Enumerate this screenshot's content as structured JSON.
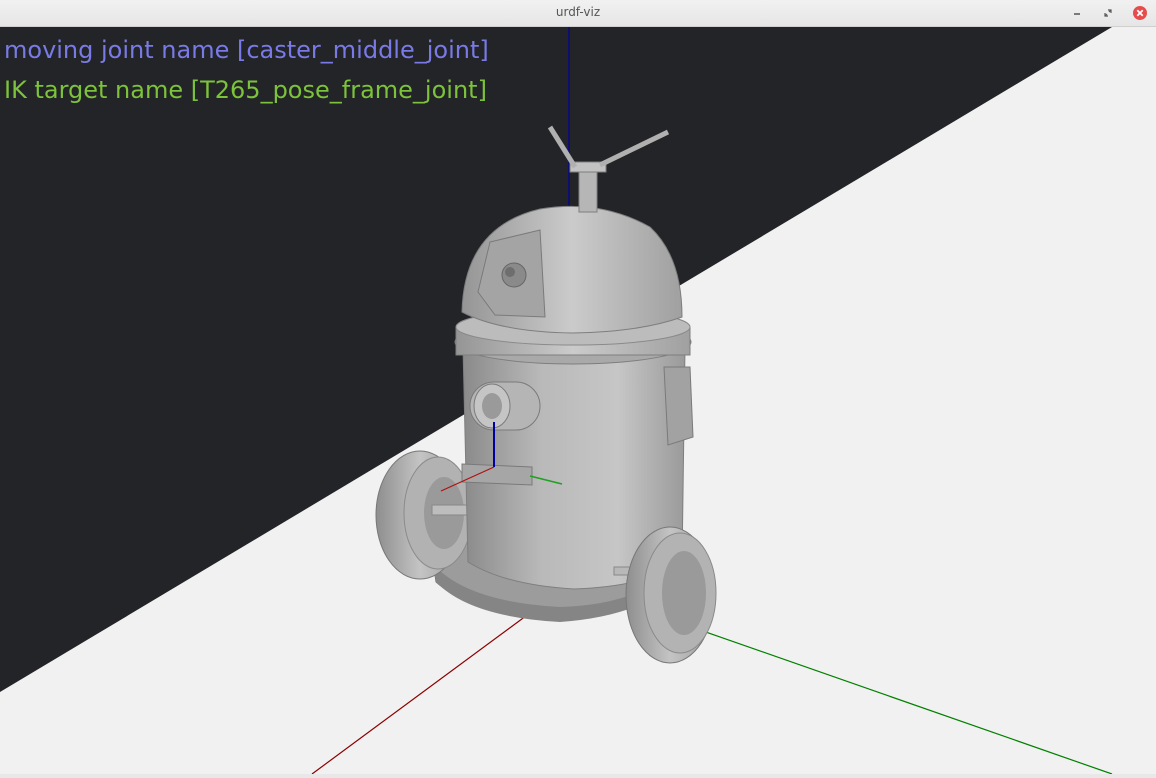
{
  "window": {
    "title": "urdf-viz"
  },
  "controls": {
    "minimize_icon": "minimize-icon",
    "restore_icon": "restore-icon",
    "close_icon": "close-icon"
  },
  "overlay": {
    "moving_joint_text": "moving joint name [caster_middle_joint]",
    "ik_target_text": "IK target name [T265_pose_frame_joint]"
  },
  "colors": {
    "background_dark": "#222427",
    "ground": "#f1f1f1",
    "moving_text": "#7a7ae6",
    "ik_text": "#7cc23a",
    "close_button": "#e74c4c",
    "axis_x": "#8b0000",
    "axis_y": "#008000",
    "axis_z": "#0000a0",
    "robot": "#a8a8a8"
  }
}
